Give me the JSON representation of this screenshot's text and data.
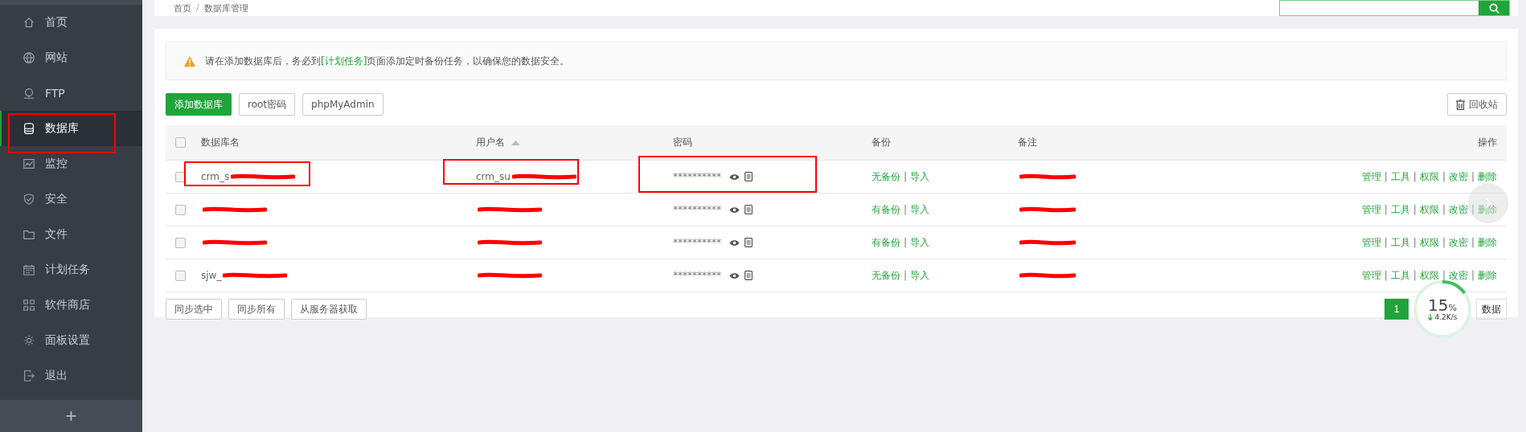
{
  "sidebar": {
    "items": [
      {
        "label": "首页",
        "selected": false
      },
      {
        "label": "网站",
        "selected": false
      },
      {
        "label": "FTP",
        "selected": false
      },
      {
        "label": "数据库",
        "selected": true
      },
      {
        "label": "监控",
        "selected": false
      },
      {
        "label": "安全",
        "selected": false
      },
      {
        "label": "文件",
        "selected": false
      },
      {
        "label": "计划任务",
        "selected": false
      },
      {
        "label": "软件商店",
        "selected": false
      },
      {
        "label": "面板设置",
        "selected": false
      },
      {
        "label": "退出",
        "selected": false
      }
    ],
    "add_button": "+"
  },
  "breadcrumb": [
    "首页",
    "/",
    "数据库管理"
  ],
  "notice": {
    "before": "请在添加数据库后，务必到",
    "link": "[计划任务]",
    "after": "页面添加定时备份任务，以确保您的数据安全。"
  },
  "toolbar": {
    "buttons": [
      {
        "label": "添加数据库",
        "primary": true
      },
      {
        "label": "root密码",
        "primary": false
      },
      {
        "label": "phpMyAdmin",
        "primary": false
      }
    ],
    "recycle": "回收站"
  },
  "table": {
    "select_all": false,
    "columns": [
      "数据库名",
      "用户名",
      "密码",
      "备份",
      "备注",
      "操作"
    ],
    "separator": "|",
    "rows": [
      {
        "checked": false,
        "db_name": "crm_s",
        "user": "crm_su",
        "password": "**********",
        "backup": "无备份",
        "import": "导入",
        "actions": [
          "管理",
          "工具",
          "权限",
          "改密",
          "删除"
        ]
      },
      {
        "checked": false,
        "password": "**********",
        "backup": "有备份",
        "import": "导入",
        "actions": [
          "管理",
          "工具",
          "权限",
          "改密",
          "删除"
        ]
      },
      {
        "checked": false,
        "password": "**********",
        "backup": "有备份",
        "import": "导入",
        "actions": [
          "管理",
          "工具",
          "权限",
          "改密",
          "删除"
        ]
      },
      {
        "checked": false,
        "db_name": "sjw_",
        "password": "**********",
        "backup": "无备份",
        "import": "导入",
        "actions": [
          "管理",
          "工具",
          "权限",
          "改密",
          "删除"
        ]
      }
    ]
  },
  "bulk_buttons": [
    "同步选中",
    "同步所有",
    "从服务器获取"
  ],
  "pagination": {
    "page": "1",
    "count": "数据"
  },
  "speed": {
    "percent": "15",
    "unit": "%",
    "rate": "4.2K/s",
    "level": 0.15
  }
}
